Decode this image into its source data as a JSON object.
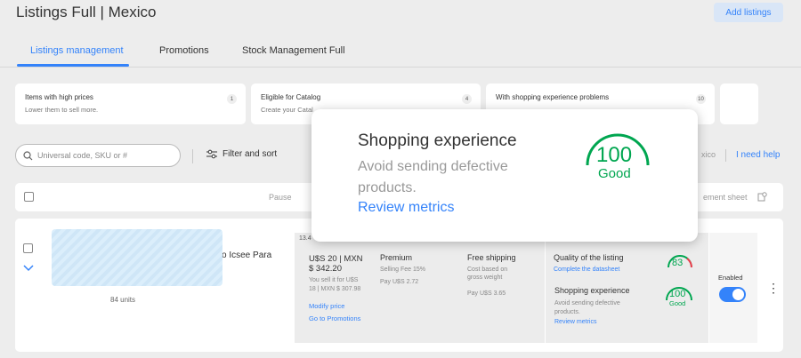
{
  "header": {
    "title": "Listings Full | Mexico",
    "add_listings": "Add listings"
  },
  "tabs": [
    {
      "label": "Listings management"
    },
    {
      "label": "Promotions"
    },
    {
      "label": "Stock Management Full"
    }
  ],
  "cards": [
    {
      "title": "Items with high prices",
      "subtitle": "Lower them to sell more.",
      "count": "1"
    },
    {
      "title": "Eligible for Catalog",
      "subtitle": "Create your Catal",
      "count": "4"
    },
    {
      "title": "With shopping experience problems",
      "subtitle": "",
      "count": "10"
    }
  ],
  "toolbar": {
    "search_placeholder": "Universal code, SKU or #",
    "filter_label": "Filter and sort",
    "region_text": "xico",
    "help_label": "I need help"
  },
  "table_header": {
    "pause": "Pause",
    "sheet": "ement sheet"
  },
  "listing": {
    "title_fragment": "o Icsee Para",
    "units": "84 units",
    "id_fragment": "13.4",
    "price_line1": "U$S 20 | MXN",
    "price_line2": "$ 342.20",
    "price_note1": "You sell it for U$S",
    "price_note2": "18 | MXN $ 307.98",
    "modify_price": "Modify price",
    "go_promotions": "Go to Promotions",
    "premium": "Premium",
    "selling_fee": "Selling Fee 15%",
    "pay_premium": "Pay U$S 2.72",
    "free_shipping": "Free shipping",
    "cost_based1": "Cost based on",
    "cost_based2": "gross weight",
    "pay_shipping": "Pay U$S 3.65",
    "quality_title": "Quality of the listing",
    "complete_datasheet": "Complete the datasheet",
    "quality_score": "83",
    "shopping_title": "Shopping experience",
    "shopping_desc1": "Avoid sending defective",
    "shopping_desc2": "products.",
    "review_metrics": "Review metrics",
    "shopping_score": "100",
    "shopping_rating": "Good",
    "enabled": "Enabled"
  },
  "popup": {
    "title": "Shopping experience",
    "desc_line1": "Avoid sending defective",
    "desc_line2": "products.",
    "link": "Review metrics",
    "score": "100",
    "rating": "Good"
  },
  "colors": {
    "accent": "#3483fa",
    "good": "#00a650"
  }
}
